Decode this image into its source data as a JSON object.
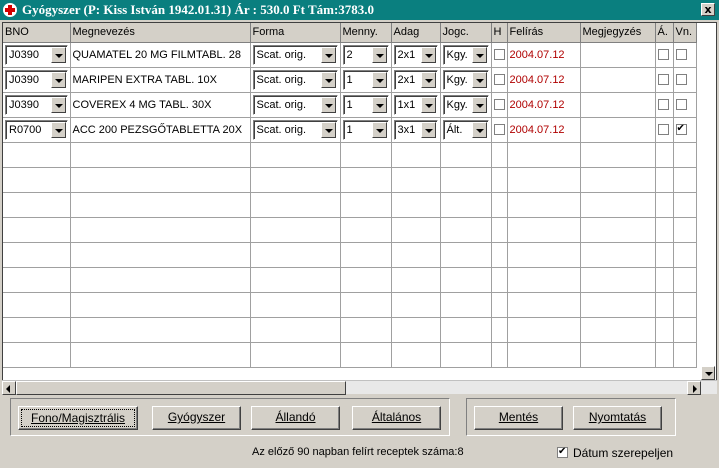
{
  "window": {
    "title": "Gyógyszer (P: Kiss István 1942.01.31) Ár : 530.0 Ft Tám:3783.0",
    "close_label": "x"
  },
  "columns": [
    "BNO",
    "Megnevezés",
    "Forma",
    "Menny.",
    "Adag",
    "Jogc.",
    "H",
    "Felírás",
    "Megjegyzés",
    "Á.",
    "Vn."
  ],
  "rows": [
    {
      "bno": "J0390",
      "name": "QUAMATEL 20 MG FILMTABL. 28",
      "forma": "Scat. orig.",
      "menny": "2",
      "adag": "2x1",
      "jogc": "Kgy.",
      "h": false,
      "felirás": "2004.07.12",
      "megjegyzes": "",
      "a": false,
      "vn": false
    },
    {
      "bno": "J0390",
      "name": "MARIPEN EXTRA TABL. 10X",
      "forma": "Scat. orig.",
      "menny": "1",
      "adag": "2x1",
      "jogc": "Kgy.",
      "h": false,
      "felirás": "2004.07.12",
      "megjegyzes": "",
      "a": false,
      "vn": false
    },
    {
      "bno": "J0390",
      "name": "COVEREX 4 MG TABL. 30X",
      "forma": "Scat. orig.",
      "menny": "1",
      "adag": "1x1",
      "jogc": "Kgy.",
      "h": false,
      "felirás": "2004.07.12",
      "megjegyzes": "",
      "a": false,
      "vn": false
    },
    {
      "bno": "R0700",
      "name": "ACC 200 PEZSGŐTABLETTA 20X",
      "forma": "Scat. orig.",
      "menny": "1",
      "adag": "3x1",
      "jogc": "Ált.",
      "h": false,
      "felirás": "2004.07.12",
      "megjegyzes": "",
      "a": false,
      "vn": true
    }
  ],
  "empty_rows": 9,
  "buttons": {
    "fono": "Fono/Magisztrális",
    "gyogyszer": "Gyógyszer",
    "allando": "Állandó",
    "altalanos": "Általános",
    "mentes": "Mentés",
    "nyomtatas": "Nyomtatás"
  },
  "status": {
    "text": "Az előző 90 napban felírt receptek száma:8"
  },
  "datum": {
    "label": "Dátum szerepeljen",
    "checked": true
  },
  "colors": {
    "title_bg": "#0a7f7f",
    "date_text": "#b00000",
    "window_bg": "#d4d0c8"
  }
}
